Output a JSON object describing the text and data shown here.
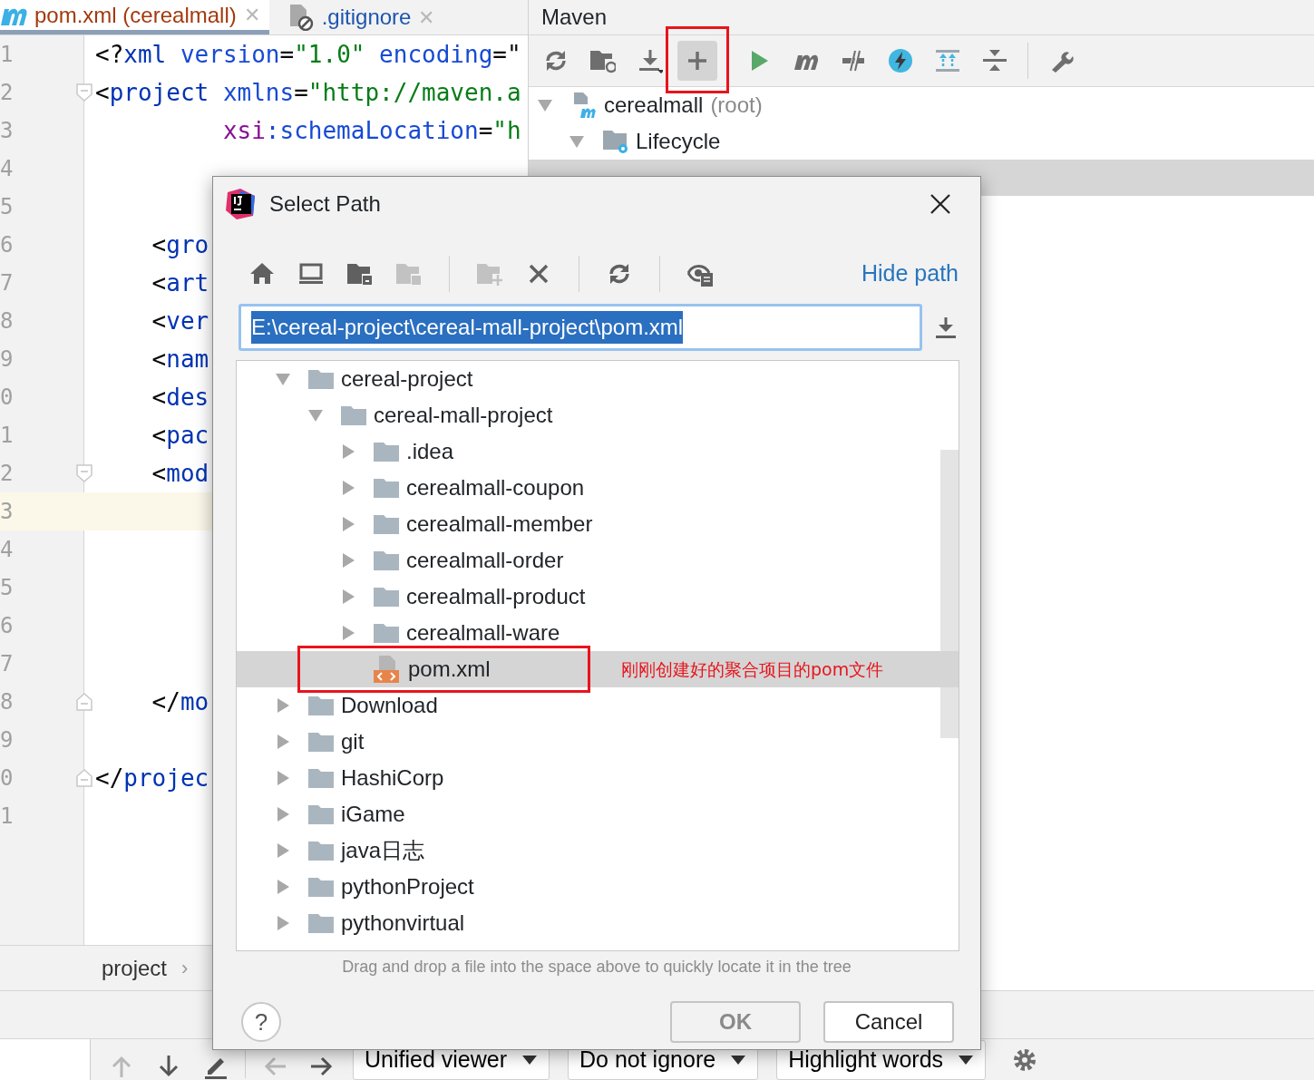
{
  "editor": {
    "tabs": [
      {
        "label": "pom.xml (cerealmall)",
        "selected": true,
        "close": "✕"
      },
      {
        "label": ".gitignore",
        "selected": false,
        "close": "✕"
      }
    ],
    "lines": [
      {
        "number": "1",
        "tokens": [
          {
            "text": "<?",
            "kind": "punct"
          },
          {
            "text": "xml",
            "kind": "tag"
          },
          {
            "text": " version",
            "kind": "attr"
          },
          {
            "text": "=",
            "kind": "punct"
          },
          {
            "text": "\"1.0\"",
            "kind": "value"
          },
          {
            "text": " encoding",
            "kind": "attr"
          },
          {
            "text": "=\"",
            "kind": "punct"
          }
        ]
      },
      {
        "number": "2",
        "fold_start": true,
        "tokens": [
          {
            "text": "<",
            "kind": "punct"
          },
          {
            "text": "project",
            "kind": "tag"
          },
          {
            "text": " xmlns",
            "kind": "attr"
          },
          {
            "text": "=",
            "kind": "punct"
          },
          {
            "text": "\"http://maven.a",
            "kind": "value"
          }
        ]
      },
      {
        "number": "3",
        "tokens": [
          {
            "text": "         xsi",
            "kind": "ns"
          },
          {
            "text": ":schemaLocation",
            "kind": "attr"
          },
          {
            "text": "=",
            "kind": "punct"
          },
          {
            "text": "\"h",
            "kind": "value"
          }
        ]
      },
      {
        "number": "4"
      },
      {
        "number": "5"
      },
      {
        "number": "6",
        "tokens": [
          {
            "text": "    <",
            "kind": "punct"
          },
          {
            "text": "gro",
            "kind": "tag"
          }
        ]
      },
      {
        "number": "7",
        "tokens": [
          {
            "text": "    <",
            "kind": "punct"
          },
          {
            "text": "art",
            "kind": "tag"
          }
        ]
      },
      {
        "number": "8",
        "tokens": [
          {
            "text": "    <",
            "kind": "punct"
          },
          {
            "text": "ver",
            "kind": "tag"
          }
        ]
      },
      {
        "number": "9",
        "tokens": [
          {
            "text": "    <",
            "kind": "punct"
          },
          {
            "text": "nam",
            "kind": "tag"
          }
        ]
      },
      {
        "number": "0",
        "tokens": [
          {
            "text": "    <",
            "kind": "punct"
          },
          {
            "text": "des",
            "kind": "tag"
          }
        ]
      },
      {
        "number": "1",
        "tokens": [
          {
            "text": "    <",
            "kind": "punct"
          },
          {
            "text": "pac",
            "kind": "tag"
          }
        ]
      },
      {
        "number": "2",
        "fold_start": true,
        "tokens": [
          {
            "text": "    <",
            "kind": "punct"
          },
          {
            "text": "mod",
            "kind": "tag"
          }
        ]
      },
      {
        "number": "3",
        "current": true
      },
      {
        "number": "4"
      },
      {
        "number": "5"
      },
      {
        "number": "6"
      },
      {
        "number": "7"
      },
      {
        "number": "8",
        "fold_end": true,
        "tokens": [
          {
            "text": "    </",
            "kind": "punct"
          },
          {
            "text": "mo",
            "kind": "tag"
          }
        ]
      },
      {
        "number": "9"
      },
      {
        "number": "0",
        "fold_end": true,
        "tokens": [
          {
            "text": "</",
            "kind": "punct"
          },
          {
            "text": "projec",
            "kind": "tag"
          }
        ]
      },
      {
        "number": "1"
      }
    ],
    "breadcrumb": {
      "label": "project",
      "separator": "›"
    }
  },
  "maven": {
    "title": "Maven",
    "toolbar": [
      {
        "active": false
      },
      {
        "active": false
      },
      {
        "active": false
      },
      {
        "active": true,
        "outlined": true
      },
      {
        "active": false
      },
      {
        "active": false
      },
      {
        "active": false
      },
      {
        "active": false
      },
      {
        "active": false
      },
      {
        "active": false
      },
      {
        "active": false
      }
    ],
    "tree": [
      {
        "label": "cerealmall",
        "suffix": "(root)",
        "expanded": true,
        "selected": false,
        "children": [
          {
            "label": "Lifecycle",
            "expanded": true,
            "selected": false,
            "children": [
              {
                "selected": true
              }
            ]
          }
        ]
      }
    ]
  },
  "dialog": {
    "title": "Select Path",
    "toolbar": [
      {
        "disabled": false
      },
      {
        "disabled": false
      },
      {
        "disabled": false
      },
      {
        "disabled": true
      },
      {
        "disabled": true
      },
      {
        "disabled": false
      },
      {
        "disabled": false
      },
      {
        "disabled": false
      }
    ],
    "hide_path": "Hide path",
    "path": "E:\\cereal-project\\cereal-mall-project\\pom.xml",
    "path_selected": true,
    "tree": [
      {
        "label": "cereal-project",
        "kind": "folder",
        "expanded": true,
        "selected": false,
        "children": [
          {
            "label": "cereal-mall-project",
            "kind": "folder",
            "expanded": true,
            "selected": false,
            "children": [
              {
                "label": ".idea",
                "kind": "folder",
                "expanded": false,
                "selected": false
              },
              {
                "label": "cerealmall-coupon",
                "kind": "folder",
                "expanded": false,
                "selected": false
              },
              {
                "label": "cerealmall-member",
                "kind": "folder",
                "expanded": false,
                "selected": false
              },
              {
                "label": "cerealmall-order",
                "kind": "folder",
                "expanded": false,
                "selected": false
              },
              {
                "label": "cerealmall-product",
                "kind": "folder",
                "expanded": false,
                "selected": false
              },
              {
                "label": "cerealmall-ware",
                "kind": "folder",
                "expanded": false,
                "selected": false
              },
              {
                "label": "pom.xml",
                "kind": "file",
                "selected": true,
                "outlined": true,
                "note": "刚刚创建好的聚合项目的pom文件"
              }
            ]
          }
        ]
      },
      {
        "label": "Download",
        "kind": "folder",
        "expanded": false,
        "selected": false
      },
      {
        "label": "git",
        "kind": "folder",
        "expanded": false,
        "selected": false
      },
      {
        "label": "HashiCorp",
        "kind": "folder",
        "expanded": false,
        "selected": false
      },
      {
        "label": "iGame",
        "kind": "folder",
        "expanded": false,
        "selected": false
      },
      {
        "label": "java日志",
        "kind": "folder",
        "expanded": false,
        "selected": false
      },
      {
        "label": "pythonProject",
        "kind": "folder",
        "expanded": false,
        "selected": false
      },
      {
        "label": "pythonvirtual",
        "kind": "folder",
        "expanded": false,
        "selected": false
      }
    ],
    "hint": "Drag and drop a file into the space above to quickly locate it in the tree",
    "help": "?",
    "buttons": [
      {
        "label": "OK",
        "disabled": true
      },
      {
        "label": "Cancel",
        "disabled": false
      }
    ]
  },
  "bottom_toolbar": {
    "buttons": [
      {
        "disabled": true
      },
      {
        "disabled": false
      },
      {
        "disabled": false
      },
      {
        "disabled": true
      },
      {
        "disabled": false
      }
    ],
    "dropdowns": [
      {
        "label": "Unified viewer"
      },
      {
        "label": "Do not ignore"
      },
      {
        "label": "Highlight words"
      }
    ]
  }
}
